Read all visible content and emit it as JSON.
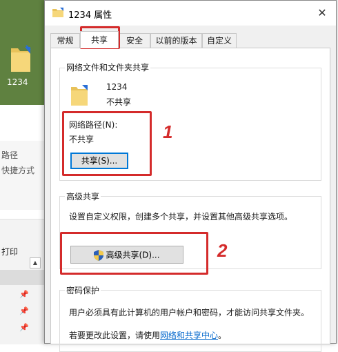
{
  "desktop": {
    "file_label": "1234"
  },
  "explorer": {
    "item_path": "路径",
    "item_shortcut": "快捷方式",
    "item_print": "打印"
  },
  "dialog": {
    "title": "1234 属性",
    "close_glyph": "✕",
    "tabs": [
      "常规",
      "共享",
      "安全",
      "以前的版本",
      "自定义"
    ],
    "active_tab": "共享",
    "network_share": {
      "group_title": "网络文件和文件夹共享",
      "folder_name": "1234",
      "folder_status": "不共享",
      "network_path_label": "网络路径(N):",
      "network_path_value": "不共享",
      "share_button": "共享(S)..."
    },
    "advanced_share": {
      "group_title": "高级共享",
      "description": "设置自定义权限，创建多个共享，并设置其他高级共享选项。",
      "button": "高级共享(D)..."
    },
    "password": {
      "group_title": "密码保护",
      "line1": "用户必须具有此计算机的用户帐户和密码，才能访问共享文件夹。",
      "line2_prefix": "若要更改此设置，请使用",
      "line2_link": "网络和共享中心",
      "line2_suffix": "。"
    }
  },
  "annotations": {
    "marker_1": "1",
    "marker_2": "2"
  },
  "colors": {
    "annotation_red": "#d42b2b",
    "link_blue": "#0066cc",
    "focus_blue": "#0078d7"
  }
}
